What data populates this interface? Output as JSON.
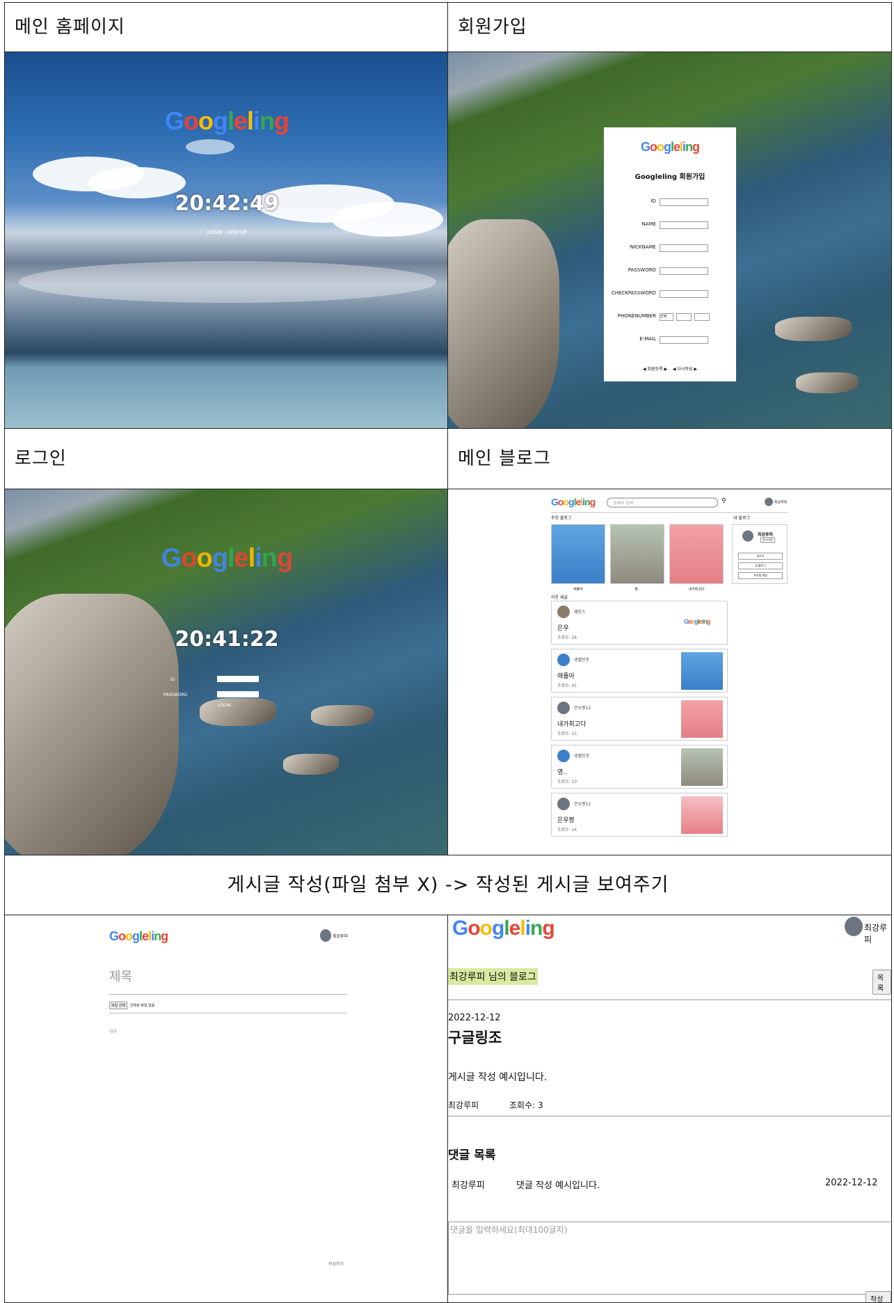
{
  "sections": {
    "main_home": "메인 홈페이지",
    "signup": "회원가입",
    "login": "로그인",
    "main_blog": "메인 블로그",
    "post_write": "게시글 작성(파일 첨부 X) -> 작성된 게시글 보여주기"
  },
  "brand": {
    "logo": "Googleling"
  },
  "home": {
    "clock": "20:42:49",
    "login_link": "LOGIN",
    "signup_link": "SIGN UP"
  },
  "signup_form": {
    "title": "Googleling 회원가입",
    "fields": [
      "ID",
      "NAME",
      "NICKNAME",
      "PASSWORD",
      "CHECKPASSWORD",
      "PHONENUMBER",
      "E-MAIL"
    ],
    "phone_select": "선택",
    "submit_label": "◀ 회원등록 ▶",
    "reset_label": "◀ 다시작성 ▶"
  },
  "login": {
    "clock": "20:41:22",
    "id_label": "ID",
    "password_label": "PASSWORD",
    "button": "LOGIN"
  },
  "blog": {
    "search_placeholder": "검색어 입력",
    "user": "최강루피",
    "recommend_title": "추천 블로그",
    "my_blog_title": "내 블로그",
    "recommended": [
      {
        "caption": "애플아"
      },
      {
        "caption": "영.."
      },
      {
        "caption": "내가최고다"
      }
    ],
    "profile_name": "최강루피",
    "profile_badge": "로그아웃",
    "side_buttons": [
      "글쓰기",
      "내 블로그",
      "프로필 편집"
    ],
    "recent_title": "이웃 새글",
    "posts": [
      {
        "author": "패킹스",
        "title": "은우",
        "views": "조회수: 26",
        "thumb": "logo"
      },
      {
        "author": "생별민주",
        "title": "애플아",
        "views": "조회수: 41",
        "thumb": "char"
      },
      {
        "author": "은우짱12",
        "title": "내가최고다",
        "views": "조회수: 15",
        "thumb": "bear"
      },
      {
        "author": "생별민주",
        "title": "영..",
        "views": "조회수: 10",
        "thumb": "cat"
      },
      {
        "author": "은우짱12",
        "title": "은우짱",
        "views": "조회수: 14",
        "thumb": "bear"
      }
    ]
  },
  "write": {
    "user": "최강루피",
    "title_placeholder": "제목",
    "file_button": "파일 선택",
    "file_status": "선택된 파일 없음",
    "content_placeholder": "내용",
    "submit": "작성하기"
  },
  "view": {
    "user": "최강루피",
    "blog_title": "최강루피 님의 블로그",
    "list_button": "목록",
    "date": "2022-12-12",
    "title": "구글링조",
    "body": "게시글 작성 예시입니다.",
    "author": "최강루피",
    "views": "조회수: 3",
    "comments_title": "댓글 목록",
    "comment": {
      "author": "최강루피",
      "text": "댓글 작성 예시입니다.",
      "date": "2022-12-12"
    },
    "comment_placeholder": "댓글을 입력하세요(최대100글자)",
    "comment_submit": "작성하기"
  },
  "colors": {
    "logo_blue": "#4285f4",
    "logo_red": "#ea4335",
    "logo_yellow": "#fbbc05",
    "logo_green": "#34a853",
    "highlight": "#d7ea9f"
  }
}
